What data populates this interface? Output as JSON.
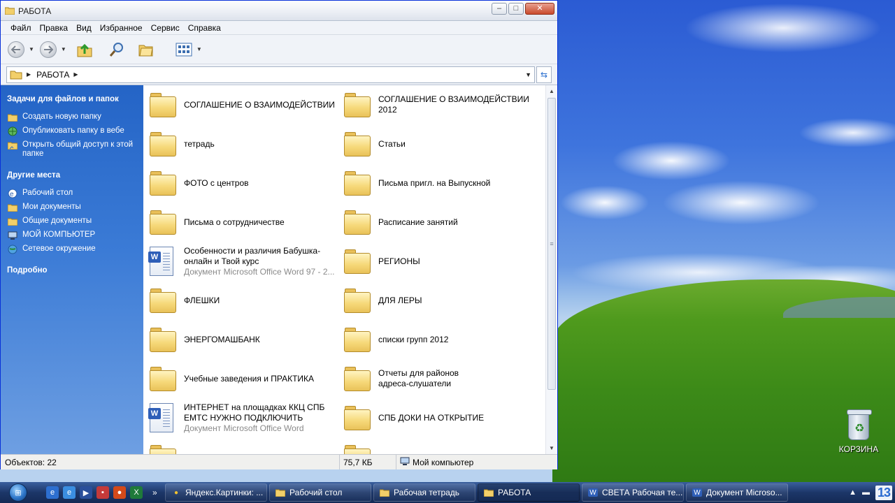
{
  "window": {
    "title": "РАБОТА",
    "buttons": {
      "minimize": "–",
      "maximize": "□",
      "close": "✕"
    }
  },
  "menu": [
    "Файл",
    "Правка",
    "Вид",
    "Избранное",
    "Сервис",
    "Справка"
  ],
  "toolbar": {
    "back_icon": "back-arrow-icon",
    "forward_icon": "forward-arrow-icon",
    "up_icon": "folder-up-icon",
    "search_icon": "search-icon",
    "folders_icon": "folders-icon",
    "views_icon": "views-icon"
  },
  "address": {
    "path": "РАБОТА"
  },
  "taskpane": {
    "tasks_heading": "Задачи для файлов и папок",
    "tasks": [
      {
        "label": "Создать новую папку",
        "icon": "new-folder-icon"
      },
      {
        "label": "Опубликовать папку в вебе",
        "icon": "publish-web-icon"
      },
      {
        "label": "Открыть общий доступ к этой папке",
        "icon": "share-folder-icon"
      }
    ],
    "places_heading": "Другие места",
    "places": [
      {
        "label": "Рабочий стол",
        "icon": "desktop-icon"
      },
      {
        "label": "Мои документы",
        "icon": "my-documents-icon"
      },
      {
        "label": "Общие документы",
        "icon": "shared-documents-icon"
      },
      {
        "label": "МОЙ КОМПЬЮТЕР",
        "icon": "my-computer-icon"
      },
      {
        "label": "Сетевое окружение",
        "icon": "network-icon"
      }
    ],
    "details_heading": "Подробно"
  },
  "files": [
    {
      "type": "folder",
      "name": "СОГЛАШЕНИЕ О ВЗАИМОДЕЙСТВИИ"
    },
    {
      "type": "folder",
      "name": "СОГЛАШЕНИЕ О ВЗАИМОДЕЙСТВИИ 2012"
    },
    {
      "type": "folder",
      "name": "тетрадь"
    },
    {
      "type": "folder",
      "name": "Статьи"
    },
    {
      "type": "folder",
      "name": "ФОТО с центров"
    },
    {
      "type": "folder",
      "name": "Письма пригл. на Выпускной"
    },
    {
      "type": "folder",
      "name": "Письма о сотрудничестве"
    },
    {
      "type": "folder",
      "name": "Расписание занятий"
    },
    {
      "type": "word",
      "name": "Особенности и различия Бабушка-онлайн и Твой курс",
      "sub": "Документ Microsoft Office Word 97 - 2..."
    },
    {
      "type": "folder",
      "name": "РЕГИОНЫ"
    },
    {
      "type": "folder",
      "name": "ФЛЕШКИ"
    },
    {
      "type": "folder",
      "name": "ДЛЯ ЛЕРЫ"
    },
    {
      "type": "folder",
      "name": "ЭНЕРГОМАШБАНК"
    },
    {
      "type": "folder",
      "name": "списки групп 2012"
    },
    {
      "type": "folder",
      "name": "Учебные заведения и ПРАКТИКА"
    },
    {
      "type": "folder",
      "name": "Отчеты для районов адреса-слушатели"
    },
    {
      "type": "word",
      "name": "ИНТЕРНЕТ на площадках ККЦ СПБ ЕМТС НУЖНО ПОДКЛЮЧИТЬ",
      "sub": "Документ Microsoft Office Word"
    },
    {
      "type": "folder",
      "name": "СПБ ДОКИ НА ОТКРЫТИЕ"
    },
    {
      "type": "folder",
      "name": ""
    },
    {
      "type": "folder",
      "name": ""
    }
  ],
  "status": {
    "objects": "Объектов: 22",
    "size": "75,7 КБ",
    "location": "Мой компьютер"
  },
  "desktop": {
    "recycle_bin": "КОРЗИНА"
  },
  "taskbar": {
    "quicklaunch": [
      "ie-icon",
      "ie-icon",
      "media-player-icon",
      "floppy-icon",
      "browser-icon",
      "excel-icon"
    ],
    "more": "»",
    "tasks": [
      {
        "label": "Яндекс.Картинки: ...",
        "icon": "yandex-icon",
        "active": false
      },
      {
        "label": "Рабочий стол",
        "icon": "folder-icon",
        "active": false
      },
      {
        "label": "Рабочая тетрадь",
        "icon": "folder-icon",
        "active": false
      },
      {
        "label": "РАБОТА",
        "icon": "folder-icon",
        "active": true
      },
      {
        "label": "СВЕТА Рабочая те...",
        "icon": "word-icon",
        "active": false
      },
      {
        "label": "Документ Microso...",
        "icon": "word-icon",
        "active": false
      }
    ],
    "clock": "13"
  }
}
